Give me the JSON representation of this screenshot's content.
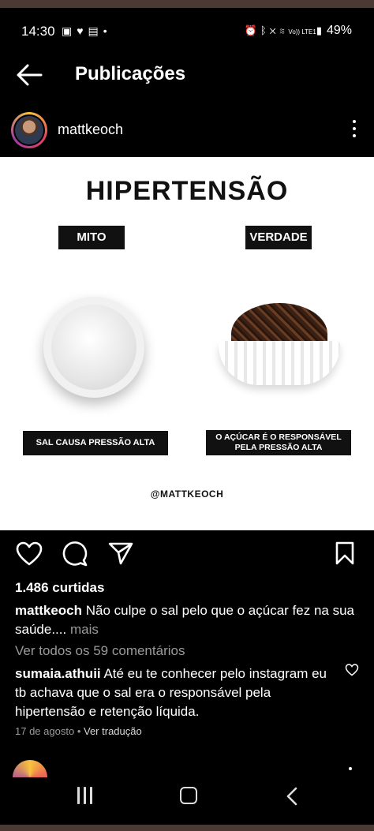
{
  "status_bar": {
    "time": "14:30",
    "left_icons": [
      "gallery-icon",
      "heart-icon",
      "linkedin-icon",
      "dot-icon"
    ],
    "right_icons": [
      "alarm-icon",
      "bluetooth-icon",
      "mute-icon",
      "wifi-icon",
      "volte-icon",
      "signal-icon"
    ],
    "volte_label": "Vo)) LTE1",
    "battery": "49%"
  },
  "app_bar": {
    "title": "Publicações"
  },
  "post_header": {
    "username": "mattkeoch"
  },
  "post_image": {
    "heading": "HIPERTENSÃO",
    "left_label": "MITO",
    "right_label": "VERDADE",
    "left_caption": "SAL CAUSA PRESSÃO ALTA",
    "right_caption_line1": "O AÇÚCAR É O RESPONSÁVEL",
    "right_caption_line2": "PELA PRESSÃO ALTA",
    "handle": "@MATTKEOCH"
  },
  "actions": [
    "heart-icon",
    "comment-icon",
    "share-icon",
    "bookmark-icon"
  ],
  "likes": "1.486 curtidas",
  "caption": {
    "username": "mattkeoch",
    "text": "Não culpe o sal pelo que o açúcar fez na sua saúde....",
    "more": "mais"
  },
  "view_all_comments": "Ver todos os 59 comentários",
  "top_comment": {
    "username": "sumaia.athuii",
    "text": "Até eu te conhecer pelo instagram eu tb achava que o sal era o responsável pela hipertensão e retenção líquida."
  },
  "comment_meta": {
    "date": "17 de agosto",
    "separator": "•",
    "translate": "Ver tradução"
  },
  "nav_bar": [
    "recent-apps-icon",
    "home-icon",
    "back-icon"
  ]
}
